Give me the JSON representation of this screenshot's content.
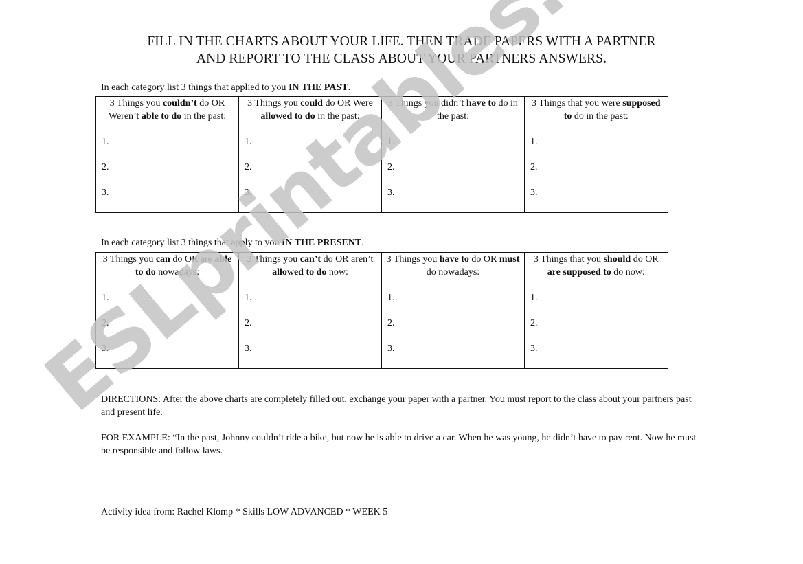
{
  "title": {
    "line1": "FILL IN THE CHARTS ABOUT YOUR LIFE.  THEN TRADE PAPERS WITH A PARTNER",
    "line2": "AND REPORT TO THE CLASS ABOUT YOUR PARTNERS ANSWERS."
  },
  "past": {
    "intro_plain": "In each category list 3 things that applied to you ",
    "intro_bold": "IN THE PAST",
    "intro_end": ".",
    "columns": [
      {
        "parts": [
          [
            "3 Things you ",
            false
          ],
          [
            "couldn’t",
            true
          ],
          [
            " do OR Weren’t ",
            false
          ],
          [
            "able to do",
            true
          ],
          [
            " in the past:",
            false
          ]
        ]
      },
      {
        "parts": [
          [
            "3 Things you ",
            false
          ],
          [
            "could",
            true
          ],
          [
            " do OR Were ",
            false
          ],
          [
            "allowed to do",
            true
          ],
          [
            " in the past:",
            false
          ]
        ]
      },
      {
        "parts": [
          [
            "3 Things you didn’t ",
            false
          ],
          [
            "have to",
            true
          ],
          [
            " do in the past:",
            false
          ]
        ]
      },
      {
        "parts": [
          [
            "3 Things that you were ",
            false
          ],
          [
            "supposed to",
            true
          ],
          [
            " do in the past:",
            false
          ]
        ]
      }
    ],
    "items": [
      "1.",
      "2.",
      "3."
    ]
  },
  "present": {
    "intro_plain": "In each category list 3 things that apply to you ",
    "intro_bold": "IN THE PRESENT",
    "intro_end": ".",
    "columns": [
      {
        "parts": [
          [
            "3 Things you ",
            false
          ],
          [
            "can",
            true
          ],
          [
            " do OR are ",
            false
          ],
          [
            "able to do",
            true
          ],
          [
            " nowadays:",
            false
          ]
        ]
      },
      {
        "parts": [
          [
            "3 Things you ",
            false
          ],
          [
            "can’t",
            true
          ],
          [
            " do OR aren’t ",
            false
          ],
          [
            "allowed to do",
            true
          ],
          [
            " now:",
            false
          ]
        ]
      },
      {
        "parts": [
          [
            "3 Things you ",
            false
          ],
          [
            "have to",
            true
          ],
          [
            " do OR ",
            false
          ],
          [
            "must",
            true
          ],
          [
            " do nowadays:",
            false
          ]
        ]
      },
      {
        "parts": [
          [
            "3 Things that you ",
            false
          ],
          [
            "should",
            true
          ],
          [
            " do OR ",
            false
          ],
          [
            "are supposed to",
            true
          ],
          [
            " do now:",
            false
          ]
        ]
      }
    ],
    "items": [
      "1.",
      "2.",
      "3."
    ]
  },
  "directions": "DIRECTIONS:  After the above charts are completely filled out, exchange your paper with a partner.  You must report to the class about your partners past and present life.",
  "example": "FOR EXAMPLE: “In the past, Johnny couldn’t ride a bike, but now he is able to drive a car.  When he was young, he didn’t have to pay rent.  Now he must be responsible and follow laws.",
  "credit": "Activity idea from: Rachel Klomp * Skills LOW ADVANCED * WEEK 5",
  "watermark": "ESLprintables.com"
}
